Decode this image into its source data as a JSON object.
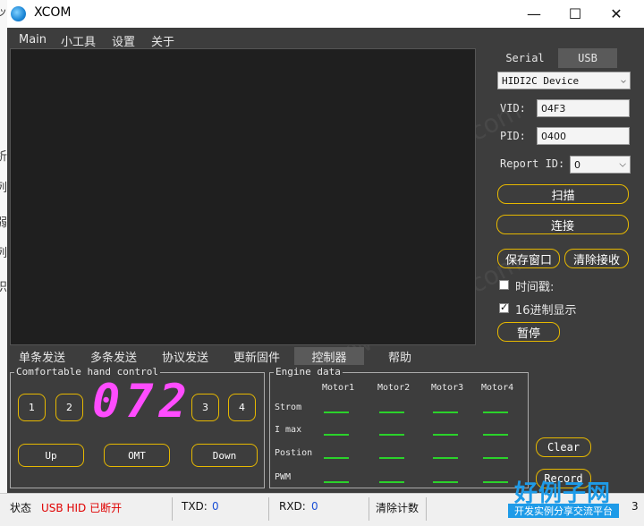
{
  "window": {
    "title": "XCOM",
    "minimize": "—",
    "maximize": "☐",
    "close": "✕"
  },
  "menu": [
    "Main",
    "小工具",
    "设置",
    "关于"
  ],
  "right_panel": {
    "tabs": [
      "Serial",
      "USB"
    ],
    "active_tab": "USB",
    "device_select": "HIDI2C Device",
    "vid_label": "VID:",
    "vid_value": "04F3",
    "pid_label": "PID:",
    "pid_value": "0400",
    "report_label": "Report ID:",
    "report_value": "0",
    "scan_button": "扫描",
    "connect_button": "连接",
    "save_window_button": "保存窗口",
    "clear_receive_button": "清除接收",
    "timestamp_label": "时间戳:",
    "timestamp_checked": false,
    "hex_label": "16进制显示",
    "hex_checked": true,
    "pause_button": "暂停"
  },
  "bottom_tabs": [
    "单条发送",
    "多条发送",
    "协议发送",
    "更新固件",
    "控制器",
    "帮助"
  ],
  "active_bottom_tab": "控制器",
  "hand_control": {
    "title": "Comfortable hand control",
    "buttons": [
      "1",
      "2",
      "3",
      "4"
    ],
    "display": "072",
    "up": "Up",
    "omt": "OMT",
    "down": "Down"
  },
  "engine": {
    "title": "Engine data",
    "motors": [
      "Motor1",
      "Motor2",
      "Motor3",
      "Motor4"
    ],
    "rows": [
      "Strom",
      "I max",
      "Postion",
      "PWM"
    ]
  },
  "clear_button": "Clear",
  "record_button": "Record",
  "status": {
    "label": "状态",
    "value": "USB HID 已断开",
    "value_color": "#e00000",
    "txd_label": "TXD:",
    "txd_value": "0",
    "rxd_label": "RXD:",
    "rxd_value": "0",
    "reset_label": "清除计数",
    "tail": "3"
  },
  "overlay": {
    "brand": "好例子网",
    "slogan": "开发实例分享交流平台"
  },
  "side_fragments": [
    "ッ",
    "析",
    "列",
    "弱",
    "列",
    "织"
  ]
}
